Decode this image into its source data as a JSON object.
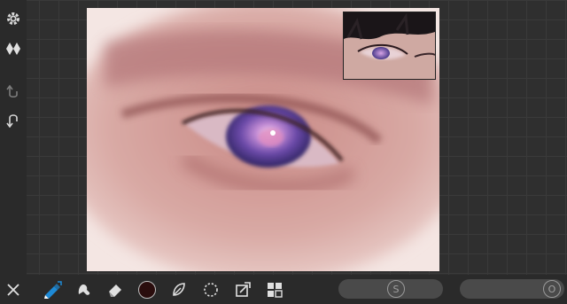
{
  "app": {
    "name": "painting-app"
  },
  "left_toolbar": {
    "items": [
      {
        "name": "settings-icon"
      },
      {
        "name": "layers-icon"
      },
      {
        "name": "undo-icon"
      },
      {
        "name": "redo-icon"
      }
    ]
  },
  "canvas": {
    "name": "drawing-canvas"
  },
  "reference": {
    "name": "reference-image"
  },
  "bottom_toolbar": {
    "tools": [
      {
        "name": "close-icon"
      },
      {
        "name": "brush-icon",
        "active": true
      },
      {
        "name": "smudge-icon"
      },
      {
        "name": "eraser-icon"
      },
      {
        "name": "color-swatch",
        "color": "#2a0d0d"
      },
      {
        "name": "leaf-icon"
      },
      {
        "name": "lasso-select-icon"
      },
      {
        "name": "transform-icon"
      },
      {
        "name": "grid-layout-icon"
      }
    ],
    "size_slider": {
      "label": "S"
    },
    "opacity_slider": {
      "label": "O"
    }
  },
  "colors": {
    "accent": "#1e8ad6",
    "current_color": "#2a0d0d"
  }
}
